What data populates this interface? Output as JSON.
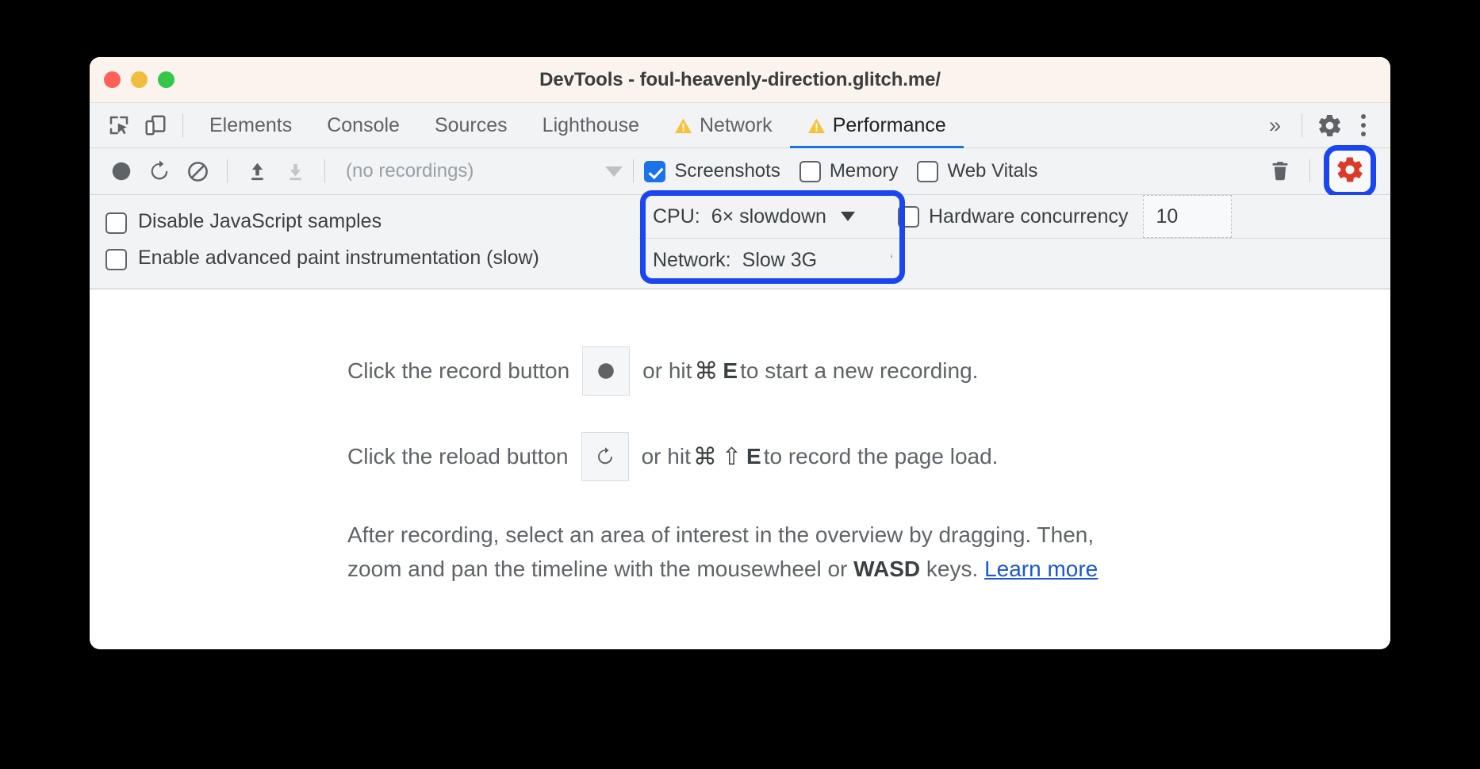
{
  "window": {
    "title": "DevTools - foul-heavenly-direction.glitch.me/",
    "traffic_lights": [
      "close",
      "minimize",
      "maximize"
    ]
  },
  "tabbar": {
    "left_icons": [
      {
        "name": "inspect-element-icon",
        "label": "Inspect element"
      },
      {
        "name": "device-toolbar-icon",
        "label": "Toggle device toolbar"
      }
    ],
    "tabs": [
      {
        "label": "Elements",
        "active": false,
        "warning": false
      },
      {
        "label": "Console",
        "active": false,
        "warning": false
      },
      {
        "label": "Sources",
        "active": false,
        "warning": false
      },
      {
        "label": "Lighthouse",
        "active": false,
        "warning": false
      },
      {
        "label": "Network",
        "active": false,
        "warning": true
      },
      {
        "label": "Performance",
        "active": true,
        "warning": true
      }
    ],
    "overflow_label": "»",
    "settings_icon": "gear-icon",
    "more_icon": "kebab-menu-icon"
  },
  "perf_toolbar": {
    "record_icon": "record-circle-icon",
    "reload_icon": "reload-record-icon",
    "clear_icon": "clear-no-entry-icon",
    "upload_icon": "load-profile-up-arrow-icon",
    "download_icon": "save-profile-down-arrow-icon",
    "recordings_label": "(no recordings)",
    "recordings_caret": "chevron-down-icon",
    "checkboxes": [
      {
        "label": "Screenshots",
        "checked": true
      },
      {
        "label": "Memory",
        "checked": false
      },
      {
        "label": "Web Vitals",
        "checked": false
      }
    ],
    "trash_icon": "delete-trash-icon",
    "capture_settings_icon": "capture-settings-gear-icon",
    "capture_settings_color": "#db3a29",
    "highlight_color": "#1a45f0"
  },
  "capture_settings": {
    "left_checkboxes": [
      {
        "label": "Disable JavaScript samples",
        "checked": false
      },
      {
        "label": "Enable advanced paint instrumentation (slow)",
        "checked": false
      }
    ],
    "throttling": {
      "cpu_label": "CPU:",
      "cpu_value": "6× slowdown",
      "network_label": "Network:",
      "network_value": "Slow 3G"
    },
    "hardware_concurrency": {
      "label": "Hardware concurrency",
      "checked": false,
      "value": "10"
    }
  },
  "landing": {
    "record_line": {
      "prefix": "Click the record button",
      "mid": "or hit",
      "cmd": "⌘",
      "key": "E",
      "suffix": "to start a new recording."
    },
    "reload_line": {
      "prefix": "Click the reload button",
      "mid": "or hit",
      "cmd": "⌘",
      "shift": "⇧",
      "key": "E",
      "suffix": "to record the page load."
    },
    "paragraph": {
      "part1": "After recording, select an area of interest in the overview by dragging. Then, zoom and pan the timeline with the mousewheel or ",
      "bold": "WASD",
      "part2": " keys. ",
      "link": "Learn more"
    }
  },
  "colors": {
    "accent_blue": "#1a73e8",
    "highlight_blue": "#1a45f0",
    "gear_red": "#db3a29",
    "warning_yellow": "#f5c33b",
    "link_blue": "#1a56d6"
  }
}
